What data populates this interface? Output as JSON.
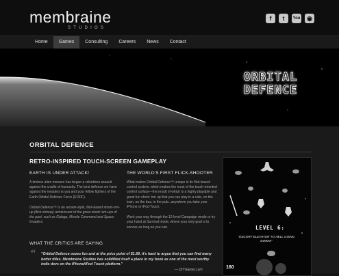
{
  "brand": {
    "name": "membraine",
    "sub": "STUDIOS"
  },
  "social": [
    {
      "icon": "facebook-icon",
      "glyph": "f"
    },
    {
      "icon": "twitter-icon",
      "glyph": "t"
    },
    {
      "icon": "youtube-icon",
      "glyph": "You"
    },
    {
      "icon": "rss-icon",
      "glyph": "◉"
    }
  ],
  "nav": [
    {
      "label": "Home",
      "active": false
    },
    {
      "label": "Games",
      "active": true
    },
    {
      "label": "Consulting",
      "active": false
    },
    {
      "label": "Careers",
      "active": false
    },
    {
      "label": "News",
      "active": false
    },
    {
      "label": "Contact",
      "active": false
    }
  ],
  "banner": {
    "line1": "ORBITAL",
    "line2": "DEFENCE"
  },
  "page": {
    "title": "ORBITAL DEFENCE",
    "subtitle": "RETRO-INSPIRED TOUCH-SCREEN GAMEPLAY",
    "col1": {
      "heading": "EARTH IS UNDER ATTACK!",
      "p1": "A tireless alien menace has begun a relentless assault against the cradle of humanity. The best defence we have against the invaders is you and your fellow fighters of the Earth Orbital Defence Force (EODF).",
      "p2": "Orbital Defence™ is an arcade-style, flick-based shoot-'em-up (flick-shmup) reminiscent of the great shoot-'em-ups of the past, such as Galaga, Missile Command and Space Invaders."
    },
    "col2": {
      "heading": "THE WORLD'S FIRST FLICK-SHOOTER",
      "p1": "What makes Orbital Defence™ unique is its flick-based control system, which makes the most of the touch-oriented control surface—the result of which is a highly playable and great fun shoot 'em up that you can play in a cafe, on the train, on the bus, in the pub...anywhere you take your iPhone or iPod Touch.",
      "p2": "Work your way through the 12-level Campaign mode or try your hand at Survival mode, where your only goal is to survive as long as you can."
    },
    "critics_heading": "WHAT THE CRITICS ARE SAYING",
    "quote": "\"Orbital Defence oozes fun and at the price point of $1.99, it's hard to argue that you can find many better titles. Membraine Studios has solidified itself a place in my book as one of the most worthy indie devs on the iPhone/iPod Touch platform.\"",
    "quote_attr": "— DIYGamer.com"
  },
  "phone": {
    "level": "LEVEL 6:",
    "escort": "\"ESCORT ELEVATOR TO HELL GOING DOWN!\"",
    "hud": "160"
  }
}
